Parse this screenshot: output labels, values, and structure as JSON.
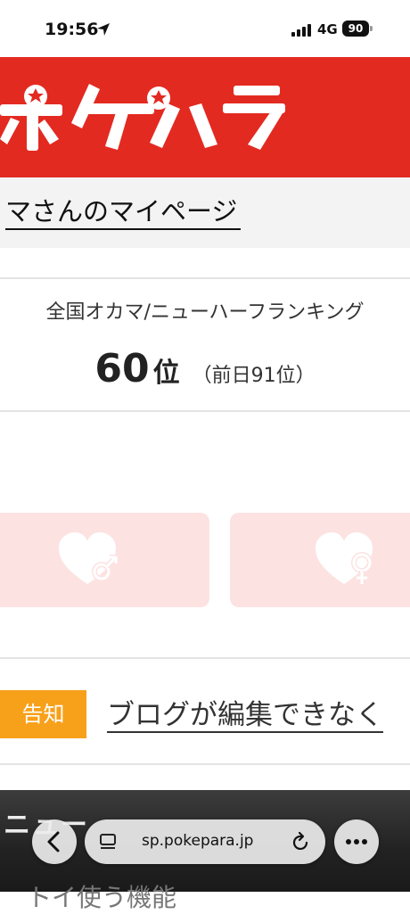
{
  "status_bar": {
    "time": "19:56",
    "network": "4G",
    "battery": "90"
  },
  "header": {
    "logo_text": "ポケパラ",
    "background_color": "#e32a21",
    "logo_icon": "star-logo"
  },
  "page": {
    "title": "マさんのマイページ"
  },
  "ranking": {
    "label": "全国オカマ/ニューハーフランキング",
    "rank": "60",
    "unit": "位",
    "previous": "（前日91位）"
  },
  "cards": [
    {
      "icon": "heart-male-icon"
    },
    {
      "icon": "heart-female-icon"
    }
  ],
  "notice": {
    "badge": "告知",
    "badge_color": "#f7a01a",
    "link_text": "ブログが編集できなく"
  },
  "menu": {
    "heading": "ニュー",
    "subtext": "トイ使う機能"
  },
  "browser": {
    "url": "sp.pokepara.jp"
  }
}
